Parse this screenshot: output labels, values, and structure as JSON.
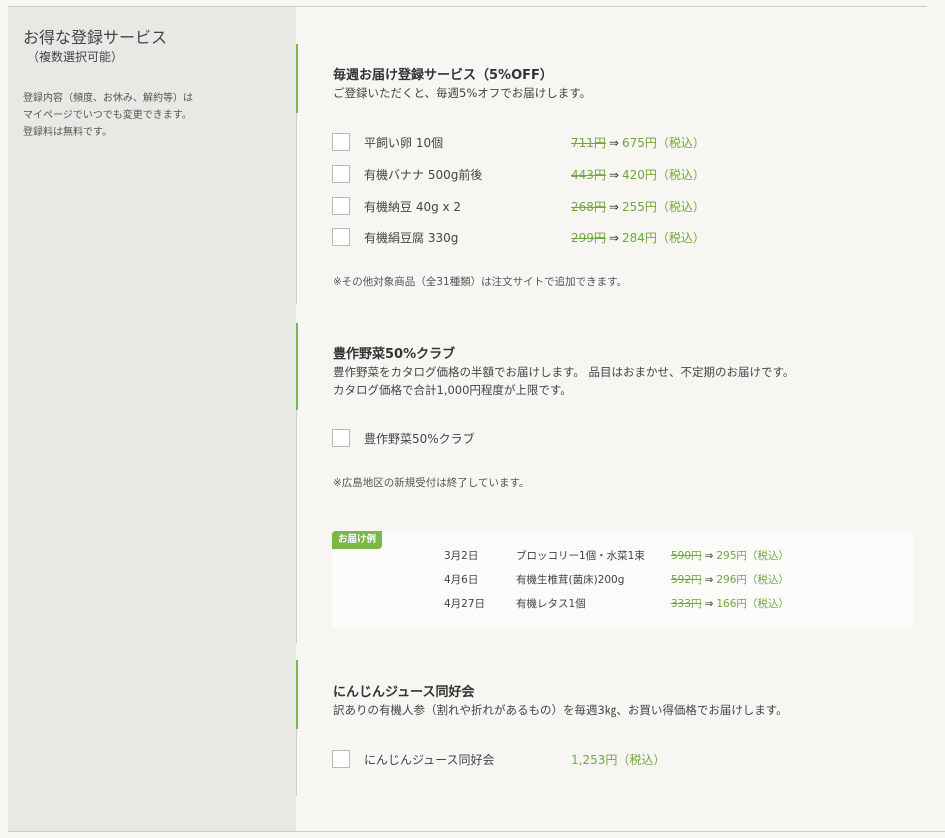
{
  "sidebar": {
    "title": "お得な登録サービス",
    "subtitle": "（複数選択可能）",
    "note_lines": [
      "登録内容（頻度、お休み、解約等）は",
      "マイページでいつでも変更できます。",
      "登録料は無料です。"
    ]
  },
  "sections": [
    {
      "title": "毎週お届け登録サービス（5%OFF）",
      "description": [
        "ご登録いただくと、毎週5%オフでお届けします。"
      ],
      "items": [
        {
          "label": "平飼い卵 10個",
          "old_price": "711円",
          "arrow": "⇒",
          "new_price": "675円（税込）",
          "checked": false
        },
        {
          "label": "有機バナナ 500g前後",
          "old_price": "443円",
          "arrow": "⇒",
          "new_price": "420円（税込）",
          "checked": false
        },
        {
          "label": "有機納豆 40g x 2",
          "old_price": "268円",
          "arrow": "⇒",
          "new_price": "255円（税込）",
          "checked": false
        },
        {
          "label": "有機絹豆腐 330g",
          "old_price": "299円",
          "arrow": "⇒",
          "new_price": "284円（税込）",
          "checked": false
        }
      ],
      "note": "※その他対象商品（全31種類）は注文サイトで追加できます。"
    },
    {
      "title": "豊作野菜50%クラブ",
      "description": [
        "豊作野菜をカタログ価格の半額でお届けします。 品目はおまかせ、不定期のお届けです。",
        "カタログ価格で合計1,000円程度が上限です。"
      ],
      "items": [
        {
          "label": "豊作野菜50%クラブ",
          "checked": false
        }
      ],
      "note": "※広島地区の新規受付は終了しています。",
      "example": {
        "badge": "お届け例",
        "rows": [
          {
            "date": "3月2日",
            "name": "ブロッコリー1個・水菜1束",
            "old_price": "590円",
            "arrow": "⇒",
            "new_price": "295円（税込）"
          },
          {
            "date": "4月6日",
            "name": "有機生椎茸(菌床)200g",
            "old_price": "592円",
            "arrow": "⇒",
            "new_price": "296円（税込）"
          },
          {
            "date": "4月27日",
            "name": "有機レタス1個",
            "old_price": "333円",
            "arrow": "⇒",
            "new_price": "166円（税込）"
          }
        ]
      }
    },
    {
      "title": "にんじんジュース同好会",
      "description": [
        "訳ありの有機人参（割れや折れがあるもの）を毎週3㎏、お買い得価格でお届けします。"
      ],
      "items": [
        {
          "label": "にんじんジュース同好会",
          "price": "1,253円（税込）",
          "checked": false
        }
      ]
    }
  ],
  "colors": {
    "accent": "#7ab648",
    "price": "#6ea83f",
    "sidebar_bg": "#e9e8e4",
    "page_bg": "#f7f6f3"
  }
}
